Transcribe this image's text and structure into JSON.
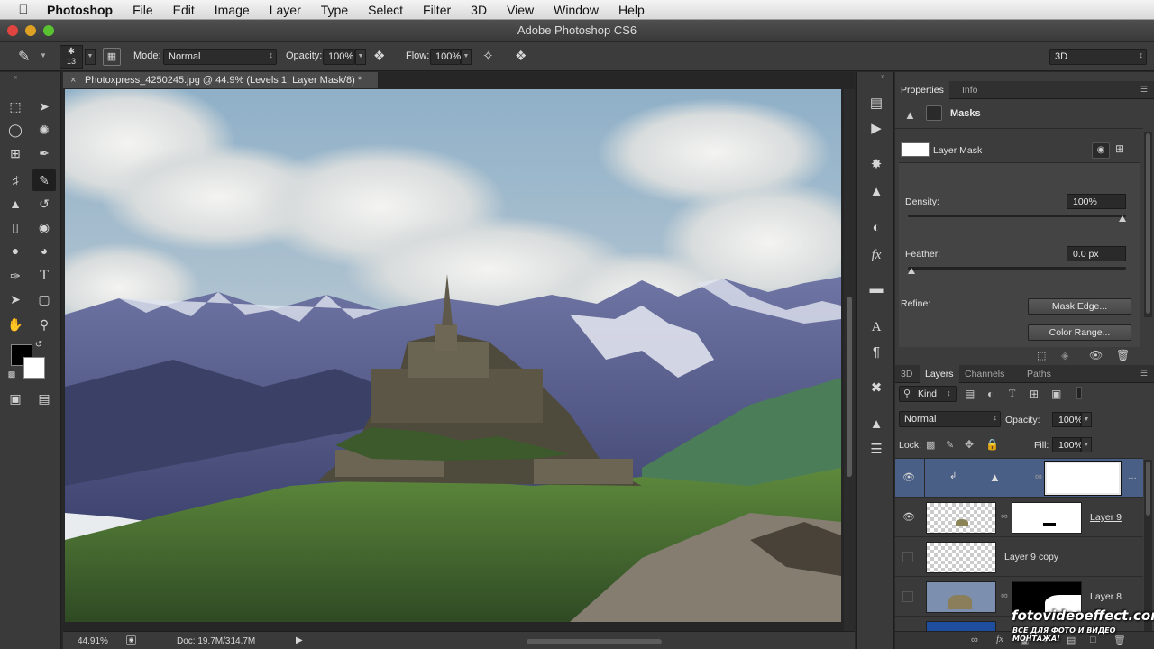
{
  "menubar": {
    "app_name": "Photoshop",
    "items": [
      {
        "label": "File"
      },
      {
        "label": "Edit"
      },
      {
        "label": "Image"
      },
      {
        "label": "Layer"
      },
      {
        "label": "Type"
      },
      {
        "label": "Select"
      },
      {
        "label": "Filter"
      },
      {
        "label": "3D"
      },
      {
        "label": "View"
      },
      {
        "label": "Window"
      },
      {
        "label": "Help"
      }
    ]
  },
  "window": {
    "title": "Adobe Photoshop CS6"
  },
  "options": {
    "brush_size": "13",
    "mode_label": "Mode:",
    "mode_value": "Normal",
    "opacity_label": "Opacity:",
    "opacity_value": "100%",
    "flow_label": "Flow:",
    "flow_value": "100%",
    "workspace_value": "3D"
  },
  "document": {
    "tab_title": "Photoxpress_4250245.jpg @ 44.9% (Levels 1, Layer Mask/8) *",
    "zoom": "44.91%",
    "doc_info": "Doc: 19.7M/314.7M"
  },
  "properties": {
    "tabs": [
      {
        "label": "Properties"
      },
      {
        "label": "Info"
      }
    ],
    "section_title": "Masks",
    "mask_label": "Layer Mask",
    "density_label": "Density:",
    "density_value": "100%",
    "density_level": 1.0,
    "feather_label": "Feather:",
    "feather_value": "0.0 px",
    "feather_level": 0.0,
    "refine_label": "Refine:",
    "mask_edge_button": "Mask Edge...",
    "color_range_button": "Color Range..."
  },
  "layers_panel": {
    "tabs": [
      {
        "label": "3D"
      },
      {
        "label": "Layers"
      },
      {
        "label": "Channels"
      },
      {
        "label": "Paths"
      }
    ],
    "filter_kind": "Kind",
    "blend_mode": "Normal",
    "opacity_label": "Opacity:",
    "opacity_value": "100%",
    "lock_label": "Lock:",
    "fill_label": "Fill:",
    "fill_value": "100%",
    "layers": [
      {
        "name": "",
        "visible": true,
        "selected": true
      },
      {
        "name": "Layer 9",
        "visible": true,
        "selected": false
      },
      {
        "name": "Layer 9 copy",
        "visible": false,
        "selected": false
      },
      {
        "name": "Layer 8",
        "visible": false,
        "selected": false
      }
    ]
  },
  "watermark": {
    "line1": "fotovideoeffect.com",
    "line2": "ВСЕ ДЛЯ ФОТО И ВИДЕО МОНТАЖА!"
  },
  "colors": {
    "foreground": "#000000",
    "background": "#ffffff",
    "selected_layer": "#4a5f86"
  }
}
